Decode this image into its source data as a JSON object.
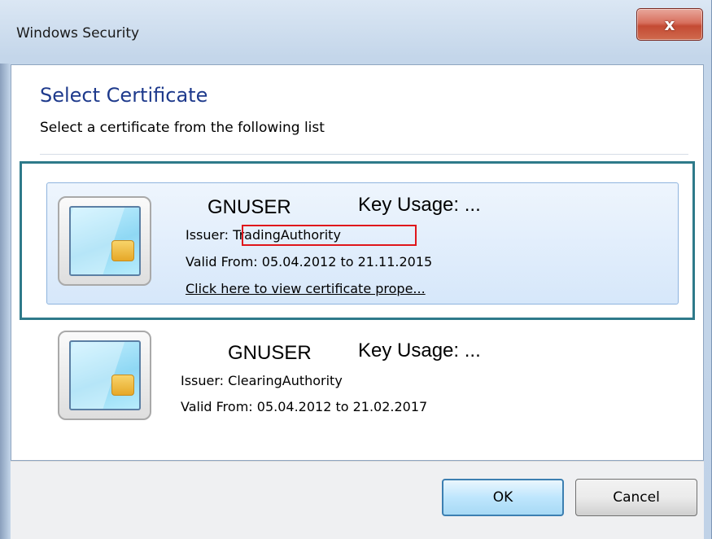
{
  "window": {
    "title": "Windows Security",
    "close_label": "x"
  },
  "dialog": {
    "heading": "Select Certificate",
    "subtext": "Select a certificate from the following list"
  },
  "certificates": [
    {
      "name": "GNUSER",
      "key_usage": "Key Usage: ...",
      "issuer_label": "Issuer:",
      "issuer": "TradingAuthority",
      "valid": "Valid From: 05.04.2012 to 21.11.2015",
      "link": "Click here to view certificate prope...",
      "selected": true
    },
    {
      "name": "GNUSER",
      "key_usage": "Key Usage: ...",
      "issuer_label": "Issuer:",
      "issuer": "ClearingAuthority",
      "valid": "Valid From: 05.04.2012 to 21.02.2017",
      "selected": false
    }
  ],
  "buttons": {
    "ok": "OK",
    "cancel": "Cancel"
  },
  "icons": {
    "close": "close-icon",
    "certificate": "smart-card-certificate-icon"
  },
  "colors": {
    "heading": "#1e3a8c",
    "highlight_frame": "#2e7a8a",
    "issuer_highlight": "#e0161b",
    "close_button": "#c44a33"
  }
}
